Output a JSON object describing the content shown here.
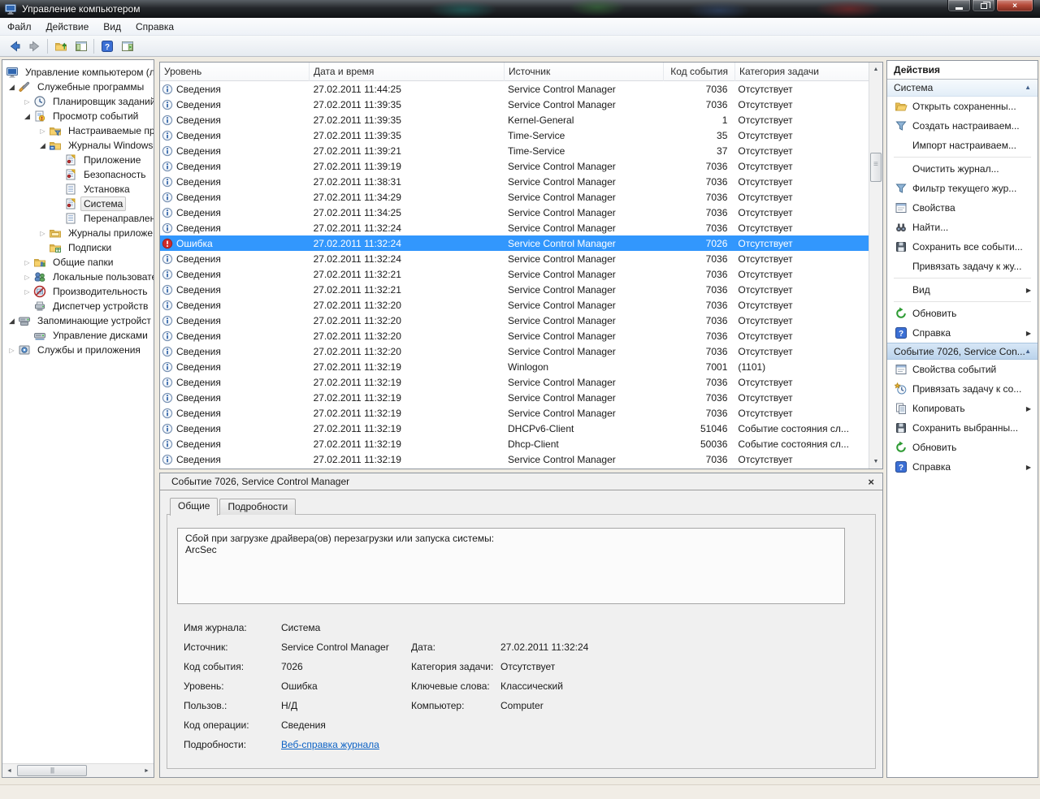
{
  "window": {
    "title": "Управление компьютером",
    "controls": [
      {
        "name": "minimize"
      },
      {
        "name": "restore"
      },
      {
        "name": "close",
        "glyph": "×"
      }
    ]
  },
  "menu": {
    "items": [
      "Файл",
      "Действие",
      "Вид",
      "Справка"
    ]
  },
  "toolbar": {
    "buttons": [
      {
        "icon": "back"
      },
      {
        "icon": "forward"
      },
      {
        "separator": true
      },
      {
        "icon": "up-folder"
      },
      {
        "icon": "console-tree"
      },
      {
        "separator": true
      },
      {
        "icon": "help"
      },
      {
        "icon": "action-pane"
      }
    ]
  },
  "tree": {
    "items": [
      {
        "label": "Управление компьютером (л",
        "level": 0,
        "expander": "none",
        "icon": "computer"
      },
      {
        "label": "Служебные программы",
        "level": 1,
        "expander": "expanded",
        "icon": "tools"
      },
      {
        "label": "Планировщик заданий",
        "level": 2,
        "expander": "collapsed",
        "icon": "scheduler"
      },
      {
        "label": "Просмотр событий",
        "level": 2,
        "expander": "expanded",
        "icon": "event-viewer"
      },
      {
        "label": "Настраиваемые пр",
        "level": 3,
        "expander": "collapsed",
        "icon": "folder-filter"
      },
      {
        "label": "Журналы Windows",
        "level": 3,
        "expander": "expanded",
        "icon": "folder-logs"
      },
      {
        "label": "Приложение",
        "level": 4,
        "expander": "none",
        "icon": "log-marked"
      },
      {
        "label": "Безопасность",
        "level": 4,
        "expander": "none",
        "icon": "log-marked"
      },
      {
        "label": "Установка",
        "level": 4,
        "expander": "none",
        "icon": "log-plain"
      },
      {
        "label": "Система",
        "level": 4,
        "expander": "none",
        "icon": "log-marked",
        "selected": true
      },
      {
        "label": "Перенаправлен",
        "level": 4,
        "expander": "none",
        "icon": "log-plain"
      },
      {
        "label": "Журналы приложе",
        "level": 3,
        "expander": "collapsed",
        "icon": "folder-apps"
      },
      {
        "label": "Подписки",
        "level": 3,
        "expander": "none",
        "icon": "folder-subs"
      },
      {
        "label": "Общие папки",
        "level": 2,
        "expander": "collapsed",
        "icon": "shared-folders"
      },
      {
        "label": "Локальные пользовате",
        "level": 2,
        "expander": "collapsed",
        "icon": "users"
      },
      {
        "label": "Производительность",
        "level": 2,
        "expander": "collapsed",
        "icon": "performance"
      },
      {
        "label": "Диспетчер устройств",
        "level": 2,
        "expander": "none",
        "icon": "device-manager"
      },
      {
        "label": "Запоминающие устройст",
        "level": 1,
        "expander": "expanded",
        "icon": "storage"
      },
      {
        "label": "Управление дисками",
        "level": 2,
        "expander": "none",
        "icon": "disk-management"
      },
      {
        "label": "Службы и приложения",
        "level": 1,
        "expander": "collapsed",
        "icon": "services"
      }
    ]
  },
  "event_list": {
    "columns": [
      "Уровень",
      "Дата и время",
      "Источник",
      "Код события",
      "Категория задачи"
    ],
    "rows": [
      {
        "level": "Сведения",
        "icon": "info",
        "datetime": "27.02.2011 11:44:25",
        "source": "Service Control Manager",
        "code": "7036",
        "category": "Отсутствует"
      },
      {
        "level": "Сведения",
        "icon": "info",
        "datetime": "27.02.2011 11:39:35",
        "source": "Service Control Manager",
        "code": "7036",
        "category": "Отсутствует"
      },
      {
        "level": "Сведения",
        "icon": "info",
        "datetime": "27.02.2011 11:39:35",
        "source": "Kernel-General",
        "code": "1",
        "category": "Отсутствует"
      },
      {
        "level": "Сведения",
        "icon": "info",
        "datetime": "27.02.2011 11:39:35",
        "source": "Time-Service",
        "code": "35",
        "category": "Отсутствует"
      },
      {
        "level": "Сведения",
        "icon": "info",
        "datetime": "27.02.2011 11:39:21",
        "source": "Time-Service",
        "code": "37",
        "category": "Отсутствует"
      },
      {
        "level": "Сведения",
        "icon": "info",
        "datetime": "27.02.2011 11:39:19",
        "source": "Service Control Manager",
        "code": "7036",
        "category": "Отсутствует"
      },
      {
        "level": "Сведения",
        "icon": "info",
        "datetime": "27.02.2011 11:38:31",
        "source": "Service Control Manager",
        "code": "7036",
        "category": "Отсутствует"
      },
      {
        "level": "Сведения",
        "icon": "info",
        "datetime": "27.02.2011 11:34:29",
        "source": "Service Control Manager",
        "code": "7036",
        "category": "Отсутствует"
      },
      {
        "level": "Сведения",
        "icon": "info",
        "datetime": "27.02.2011 11:34:25",
        "source": "Service Control Manager",
        "code": "7036",
        "category": "Отсутствует"
      },
      {
        "level": "Сведения",
        "icon": "info",
        "datetime": "27.02.2011 11:32:24",
        "source": "Service Control Manager",
        "code": "7036",
        "category": "Отсутствует"
      },
      {
        "level": "Ошибка",
        "icon": "error",
        "datetime": "27.02.2011 11:32:24",
        "source": "Service Control Manager",
        "code": "7026",
        "category": "Отсутствует",
        "selected": true
      },
      {
        "level": "Сведения",
        "icon": "info",
        "datetime": "27.02.2011 11:32:24",
        "source": "Service Control Manager",
        "code": "7036",
        "category": "Отсутствует"
      },
      {
        "level": "Сведения",
        "icon": "info",
        "datetime": "27.02.2011 11:32:21",
        "source": "Service Control Manager",
        "code": "7036",
        "category": "Отсутствует"
      },
      {
        "level": "Сведения",
        "icon": "info",
        "datetime": "27.02.2011 11:32:21",
        "source": "Service Control Manager",
        "code": "7036",
        "category": "Отсутствует"
      },
      {
        "level": "Сведения",
        "icon": "info",
        "datetime": "27.02.2011 11:32:20",
        "source": "Service Control Manager",
        "code": "7036",
        "category": "Отсутствует"
      },
      {
        "level": "Сведения",
        "icon": "info",
        "datetime": "27.02.2011 11:32:20",
        "source": "Service Control Manager",
        "code": "7036",
        "category": "Отсутствует"
      },
      {
        "level": "Сведения",
        "icon": "info",
        "datetime": "27.02.2011 11:32:20",
        "source": "Service Control Manager",
        "code": "7036",
        "category": "Отсутствует"
      },
      {
        "level": "Сведения",
        "icon": "info",
        "datetime": "27.02.2011 11:32:20",
        "source": "Service Control Manager",
        "code": "7036",
        "category": "Отсутствует"
      },
      {
        "level": "Сведения",
        "icon": "info",
        "datetime": "27.02.2011 11:32:19",
        "source": "Winlogon",
        "code": "7001",
        "category": "(1101)"
      },
      {
        "level": "Сведения",
        "icon": "info",
        "datetime": "27.02.2011 11:32:19",
        "source": "Service Control Manager",
        "code": "7036",
        "category": "Отсутствует"
      },
      {
        "level": "Сведения",
        "icon": "info",
        "datetime": "27.02.2011 11:32:19",
        "source": "Service Control Manager",
        "code": "7036",
        "category": "Отсутствует"
      },
      {
        "level": "Сведения",
        "icon": "info",
        "datetime": "27.02.2011 11:32:19",
        "source": "Service Control Manager",
        "code": "7036",
        "category": "Отсутствует"
      },
      {
        "level": "Сведения",
        "icon": "info",
        "datetime": "27.02.2011 11:32:19",
        "source": "DHCPv6-Client",
        "code": "51046",
        "category": "Событие состояния сл..."
      },
      {
        "level": "Сведения",
        "icon": "info",
        "datetime": "27.02.2011 11:32:19",
        "source": "Dhcp-Client",
        "code": "50036",
        "category": "Событие состояния сл..."
      },
      {
        "level": "Сведения",
        "icon": "info",
        "datetime": "27.02.2011 11:32:19",
        "source": "Service Control Manager",
        "code": "7036",
        "category": "Отсутствует"
      }
    ]
  },
  "detail": {
    "title": "Событие 7026, Service Control Manager",
    "close_glyph": "×",
    "tabs": [
      {
        "label": "Общие",
        "active": true
      },
      {
        "label": "Подробности",
        "active": false
      }
    ],
    "message_lines": [
      "Сбой при загрузке драйвера(ов) перезагрузки или запуска системы:",
      "ArcSec"
    ],
    "fields": [
      {
        "l": "Имя журнала:",
        "lv": "Система",
        "r": "",
        "rv": ""
      },
      {
        "l": "Источник:",
        "lv": "Service Control Manager",
        "r": "Дата:",
        "rv": "27.02.2011 11:32:24"
      },
      {
        "l": "Код события:",
        "lv": "7026",
        "r": "Категория задачи:",
        "rv": "Отсутствует"
      },
      {
        "l": "Уровень:",
        "lv": "Ошибка",
        "r": "Ключевые слова:",
        "rv": "Классический"
      },
      {
        "l": "Пользов.:",
        "lv": "Н/Д",
        "r": "Компьютер:",
        "rv": "Computer"
      },
      {
        "l": "Код операции:",
        "lv": "Сведения",
        "r": "",
        "rv": ""
      },
      {
        "l": "Подробности:",
        "lv": "Веб-справка журнала",
        "r": "",
        "rv": "",
        "link": true
      }
    ]
  },
  "actions": {
    "title": "Действия",
    "groups": [
      {
        "header": "Система",
        "active": false,
        "items": [
          {
            "label": "Открыть сохраненны...",
            "icon": "open-folder"
          },
          {
            "label": "Создать настраиваем...",
            "icon": "filter"
          },
          {
            "label": "Импорт настраиваем...",
            "icon": "none"
          },
          {
            "separator": true
          },
          {
            "label": "Очистить журнал...",
            "icon": "none"
          },
          {
            "label": "Фильтр текущего жур...",
            "icon": "filter"
          },
          {
            "label": "Свойства",
            "icon": "properties"
          },
          {
            "label": "Найти...",
            "icon": "find"
          },
          {
            "label": "Сохранить все событи...",
            "icon": "save"
          },
          {
            "label": "Привязать задачу к жу...",
            "icon": "none"
          },
          {
            "separator": true
          },
          {
            "label": "Вид",
            "icon": "none",
            "submenu": true
          },
          {
            "separator": true
          },
          {
            "label": "Обновить",
            "icon": "refresh"
          },
          {
            "label": "Справка",
            "icon": "help",
            "submenu": true
          }
        ]
      },
      {
        "header": "Событие 7026, Service Con...",
        "active": true,
        "items": [
          {
            "label": "Свойства событий",
            "icon": "properties"
          },
          {
            "label": "Привязать задачу к со...",
            "icon": "task"
          },
          {
            "label": "Копировать",
            "icon": "copy",
            "submenu": true
          },
          {
            "label": "Сохранить выбранны...",
            "icon": "save"
          },
          {
            "label": "Обновить",
            "icon": "refresh"
          },
          {
            "label": "Справка",
            "icon": "help",
            "submenu": true
          }
        ]
      }
    ]
  },
  "colors": {
    "selection": "#3297fd",
    "error_icon": "#ce2a2a",
    "info_icon": "#2b5fa6",
    "link": "#0b61c4",
    "active_group_header": "#bbd4ec"
  }
}
